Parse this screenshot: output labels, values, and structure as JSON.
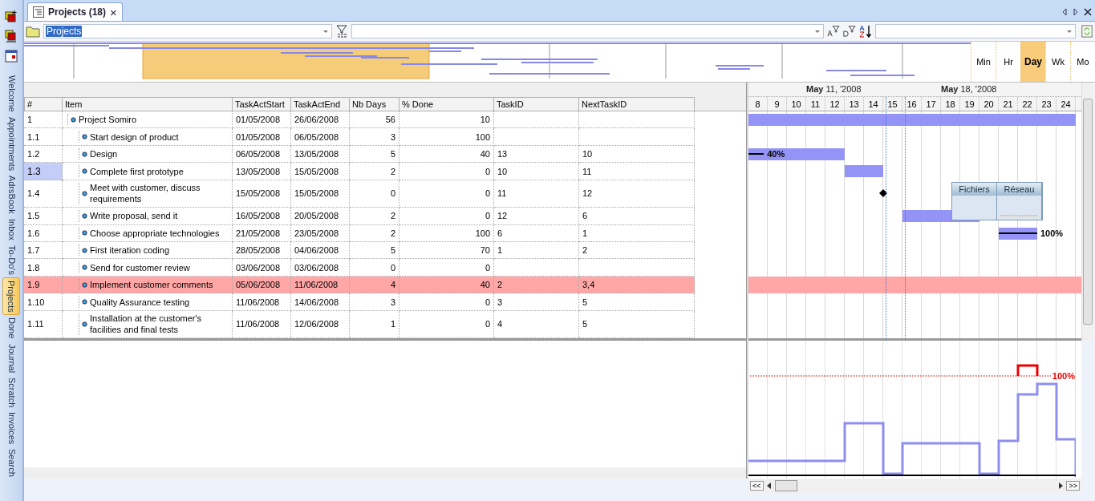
{
  "sidebar": {
    "tabs": [
      {
        "label": "Welcome",
        "selected": false
      },
      {
        "label": "Appointments",
        "selected": false
      },
      {
        "label": "AdrsBook",
        "selected": false
      },
      {
        "label": "Inbox",
        "selected": false
      },
      {
        "label": "To-Do's",
        "selected": false
      },
      {
        "label": "Projects",
        "selected": true
      },
      {
        "label": "Done",
        "selected": false
      },
      {
        "label": "Journal",
        "selected": false
      },
      {
        "label": "Scratch",
        "selected": false
      },
      {
        "label": "Invoices",
        "selected": false
      },
      {
        "label": "Search",
        "selected": false
      }
    ]
  },
  "document_tab": {
    "title": "Projects (18)",
    "close": "×"
  },
  "toolbar": {
    "view": "Projects"
  },
  "zoom_levels": [
    {
      "label": "Min",
      "selected": false
    },
    {
      "label": "Hr",
      "selected": false
    },
    {
      "label": "Day",
      "selected": true
    },
    {
      "label": "Wk",
      "selected": false
    },
    {
      "label": "Mo",
      "selected": false
    }
  ],
  "table": {
    "columns": [
      "#",
      "Item",
      "TaskActStart",
      "TaskActEnd",
      "Nb Days",
      "% Done",
      "TaskID",
      "NextTaskID"
    ],
    "rows": [
      {
        "number": "1",
        "item": "Project Somiro",
        "start": "01/05/2008",
        "end": "26/06/2008",
        "days": "56",
        "done": "10",
        "selected": false,
        "highlighted": false,
        "children": [
          {
            "number": "1.1",
            "item": "Start design of product",
            "start": "01/05/2008",
            "end": "06/05/2008",
            "days": "3",
            "done": "100",
            "selected": false,
            "highlighted": false
          },
          {
            "number": "1.2",
            "item": "Design",
            "start": "06/05/2008",
            "end": "13/05/2008",
            "days": "5",
            "done": "40",
            "task_id": "13",
            "next_task_id": "10",
            "selected": false,
            "highlighted": false,
            "bar_label": "40%"
          },
          {
            "number": "1.3",
            "item": "Complete first prototype",
            "start": "13/05/2008",
            "end": "15/05/2008",
            "days": "2",
            "done": "0",
            "task_id": "10",
            "next_task_id": "11",
            "selected": true,
            "highlighted": false
          },
          {
            "number": "1.4",
            "item": "Meet with customer, discuss requirements",
            "start": "15/05/2008",
            "end": "15/05/2008",
            "days": "0",
            "done": "0",
            "task_id": "11",
            "next_task_id": "12",
            "selected": false,
            "highlighted": false
          },
          {
            "number": "1.5",
            "item": "Write proposal, send it",
            "start": "16/05/2008",
            "end": "20/05/2008",
            "days": "2",
            "done": "0",
            "task_id": "12",
            "next_task_id": "6",
            "selected": false,
            "highlighted": false
          },
          {
            "number": "1.6",
            "item": "Choose appropriate technologies",
            "start": "21/05/2008",
            "end": "23/05/2008",
            "days": "2",
            "done": "100",
            "task_id": "6",
            "next_task_id": "1",
            "selected": false,
            "highlighted": false,
            "bar_label": "100%"
          },
          {
            "number": "1.7",
            "item": "First iteration coding",
            "start": "28/05/2008",
            "end": "04/06/2008",
            "days": "5",
            "done": "70",
            "task_id": "1",
            "next_task_id": "2",
            "selected": false,
            "highlighted": false
          },
          {
            "number": "1.8",
            "item": "Send for customer review",
            "start": "03/06/2008",
            "end": "03/06/2008",
            "days": "0",
            "done": "0",
            "selected": false,
            "highlighted": false
          },
          {
            "number": "1.9",
            "item": "Implement customer comments",
            "start": "05/06/2008",
            "end": "11/06/2008",
            "days": "4",
            "done": "40",
            "task_id": "2",
            "next_task_id": "3,4",
            "selected": false,
            "highlighted": true
          },
          {
            "number": "1.10",
            "item": "Quality Assurance testing",
            "start": "11/06/2008",
            "end": "14/06/2008",
            "days": "3",
            "done": "0",
            "task_id": "3",
            "next_task_id": "5",
            "selected": false,
            "highlighted": false
          },
          {
            "number": "1.11",
            "item": "Installation at the customer's facilities and final tests",
            "start": "11/06/2008",
            "end": "12/06/2008",
            "days": "1",
            "done": "0",
            "task_id": "4",
            "next_task_id": "5",
            "selected": false,
            "highlighted": false
          }
        ]
      }
    ]
  },
  "gantt": {
    "weeks": [
      "**May** 11, '2008",
      "**May** 18, '2008"
    ],
    "days": [
      "8",
      "9",
      "10",
      "11",
      "12",
      "13",
      "14",
      "15",
      "16",
      "17",
      "18",
      "19",
      "20",
      "21",
      "22",
      "23",
      "24"
    ],
    "overlay_widget": {
      "tabs": [
        "Fichiers",
        "Réseau"
      ]
    },
    "load_label": "100%",
    "scroll_buttons": {
      "first": "<<",
      "last": ">>"
    }
  }
}
